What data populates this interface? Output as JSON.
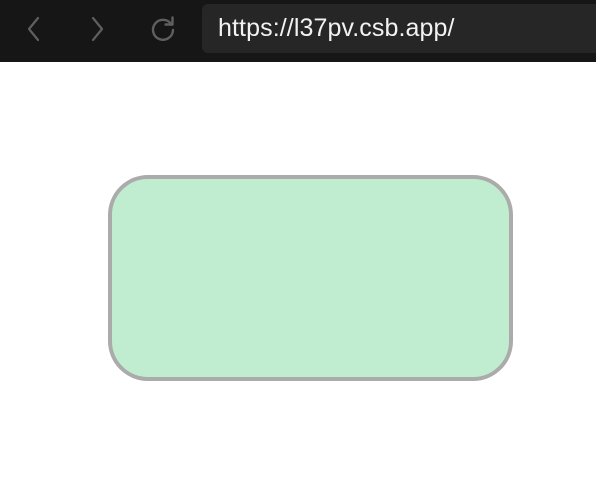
{
  "browser": {
    "url": "https://l37pv.csb.app/",
    "icons": {
      "back": "chevron-left-icon",
      "forward": "chevron-right-icon",
      "reload": "reload-icon"
    },
    "colors": {
      "toolbar_bg": "#161616",
      "address_bg": "#262626",
      "icon_color": "#5f5f5f"
    }
  },
  "page": {
    "box": {
      "fill": "#c0edcf",
      "border": "#ababab"
    }
  }
}
